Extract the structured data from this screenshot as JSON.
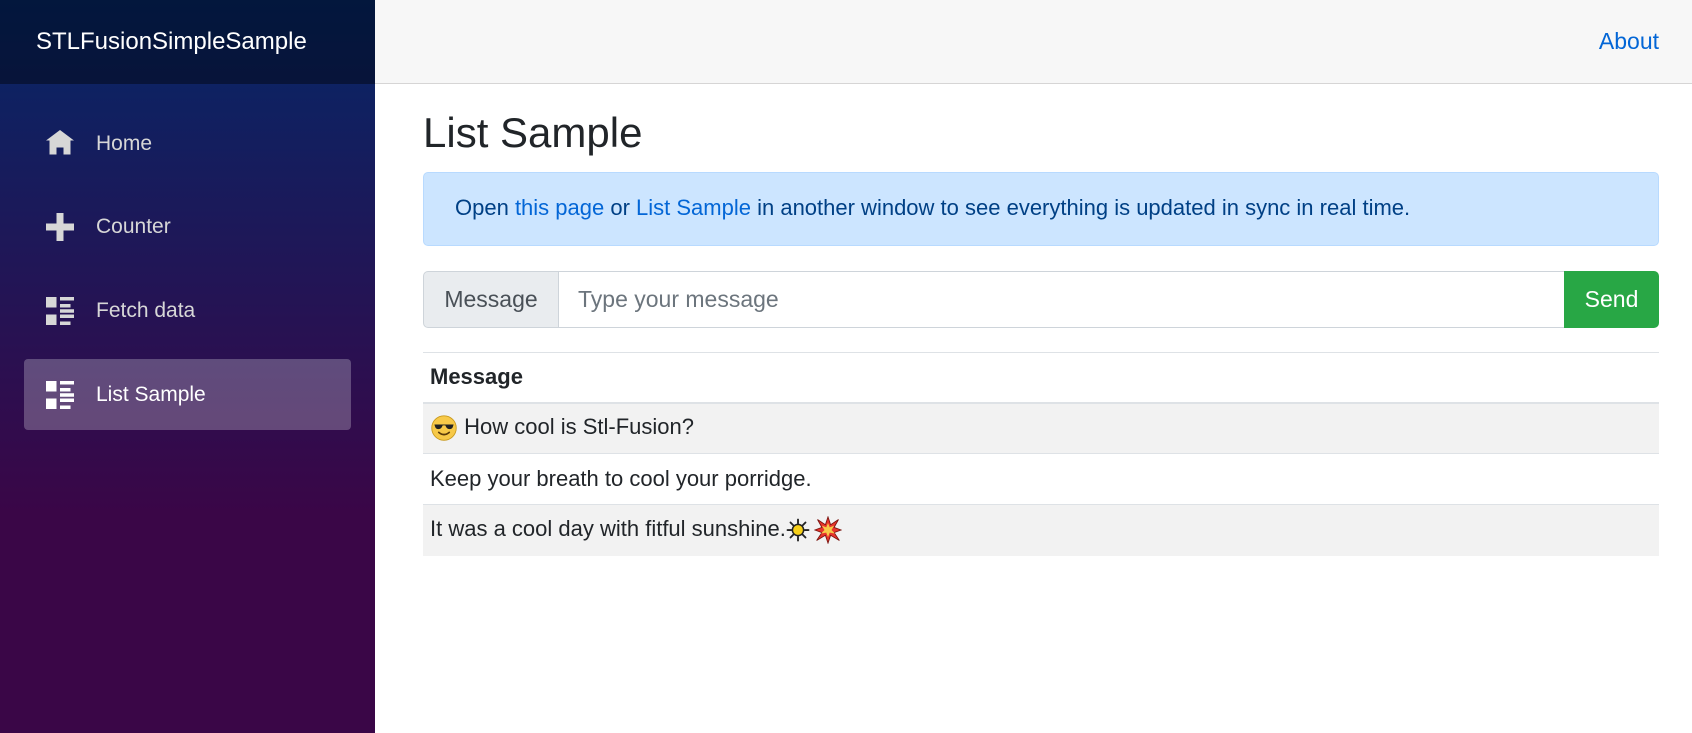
{
  "sidebar": {
    "brand": "STLFusionSimpleSample",
    "items": [
      {
        "label": "Home",
        "icon": "home-icon"
      },
      {
        "label": "Counter",
        "icon": "plus-icon"
      },
      {
        "label": "Fetch data",
        "icon": "list-rich-icon"
      },
      {
        "label": "List Sample",
        "icon": "list-rich-icon",
        "active": true
      }
    ]
  },
  "header": {
    "about_label": "About"
  },
  "main": {
    "title": "List Sample",
    "alert": {
      "prefix": "Open ",
      "link1": "this page",
      "middle": " or ",
      "link2": "List Sample",
      "suffix": " in another window to see everything is updated in sync in real time."
    },
    "input": {
      "prepend_label": "Message",
      "placeholder": "Type your message",
      "value": "",
      "send_label": "Send"
    },
    "table": {
      "header": "Message",
      "rows": [
        {
          "prefix_emoji": "smiling-face-with-sunglasses-emoji",
          "text": "How cool is Stl-Fusion?"
        },
        {
          "text": "Keep your breath to cool your porridge."
        },
        {
          "text": "It was a cool day with fitful sunshine.",
          "suffix_emojis": [
            "sun-emoji",
            "collision-emoji"
          ]
        }
      ]
    }
  },
  "colors": {
    "sidebar_gradient_top": "#052767",
    "sidebar_gradient_bottom": "#3a0647",
    "link": "#0366d6",
    "alert_bg": "#cce5ff",
    "alert_text": "#004085",
    "send_button": "#28a745"
  }
}
